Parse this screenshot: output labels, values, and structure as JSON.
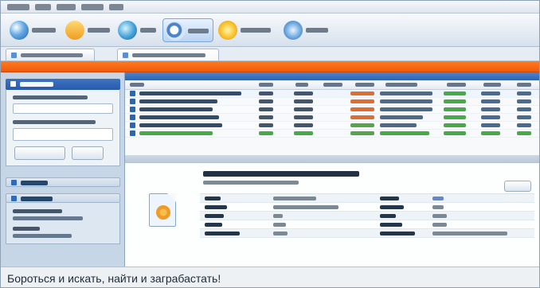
{
  "caption": "Бороться и искать, найти и заграбастать!",
  "colors": {
    "accent": "#2d63b1",
    "alert": "#f05a0b",
    "sidebar": "#c7d6e7"
  },
  "toolbar": {
    "items": [
      {
        "icon": "server-icon"
      },
      {
        "icon": "shared-files-icon"
      },
      {
        "icon": "transfers-icon"
      },
      {
        "icon": "search-icon"
      },
      {
        "icon": "statistics-icon"
      },
      {
        "icon": "network-icon"
      }
    ]
  },
  "results": {
    "rows": [
      {
        "icon": "audio-file-icon"
      },
      {
        "icon": "audio-file-icon"
      },
      {
        "icon": "audio-file-icon"
      },
      {
        "icon": "audio-file-icon"
      },
      {
        "icon": "audio-file-icon"
      },
      {
        "icon": "audio-file-icon"
      }
    ]
  },
  "details": {
    "icon": "audio-file-icon"
  }
}
